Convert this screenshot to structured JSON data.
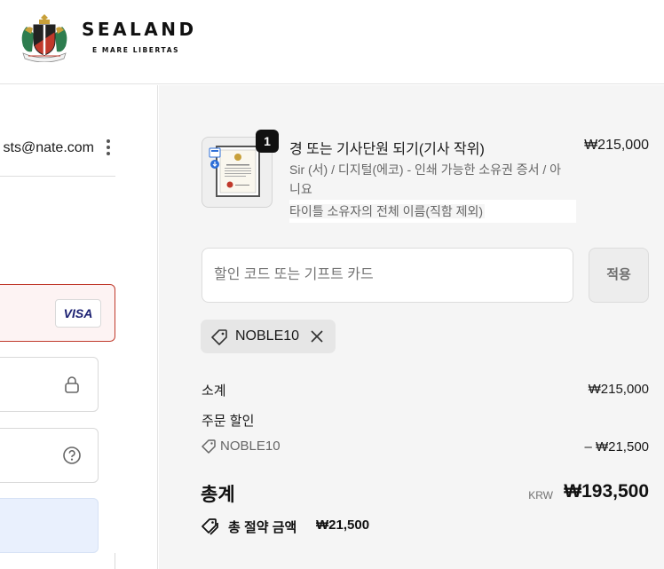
{
  "header": {
    "brand_name": "SEALAND",
    "brand_tagline": "E MARE LIBERTAS"
  },
  "contact": {
    "email_fragment": "sts@nate.com"
  },
  "payment": {
    "card_brand": "VISA"
  },
  "order": {
    "item": {
      "quantity": "1",
      "title": "경 또는 기사단원 되기(기사 작위)",
      "price": "₩215,000",
      "variant": "Sir (서) / 디지털(에코) - 인쇄 가능한 소유권 증서 / 아니요",
      "extra_label": "타이틀 소유자의 전체 이름(직함 제외)"
    },
    "discount": {
      "placeholder": "할인 코드 또는 기프트 카드",
      "apply_label": "적용",
      "applied_code": "NOBLE10"
    },
    "summary": {
      "subtotal_label": "소계",
      "subtotal_value": "₩215,000",
      "discount_label": "주문 할인",
      "discount_code": "NOBLE10",
      "discount_value": "– ₩21,500",
      "total_label": "총계",
      "total_currency": "KRW",
      "total_value": "₩193,500",
      "savings_label": "총 절약 금액",
      "savings_value": "₩21,500"
    }
  },
  "colors": {
    "accent_error": "#c0392b",
    "sidebar_bg": "#f5f5f5",
    "visa_blue": "#1a1f71"
  },
  "icons": [
    "sealand-crest-logo",
    "kebab-menu-icon",
    "lock-icon",
    "help-circle-icon",
    "tag-icon",
    "close-icon",
    "tags-icon"
  ]
}
